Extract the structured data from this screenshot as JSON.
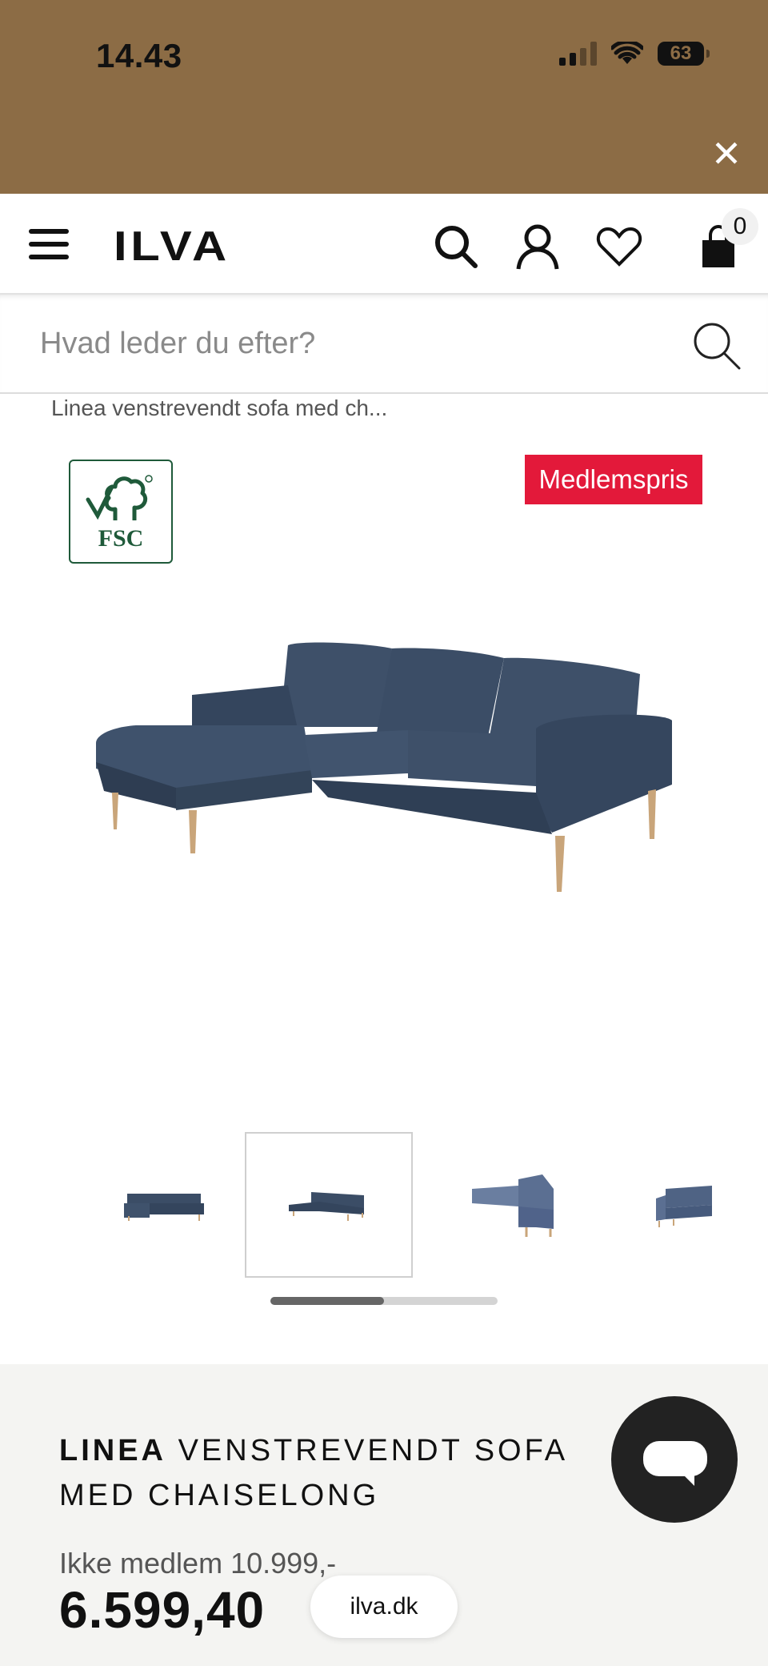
{
  "status_bar": {
    "time": "14.43",
    "battery": "63"
  },
  "promo": {
    "close_label": "✕"
  },
  "header": {
    "logo": "ILVA",
    "cart_count": "0"
  },
  "search": {
    "placeholder": "Hvad leder du efter?"
  },
  "breadcrumb": "Linea venstrevendt sofa med ch...",
  "badges": {
    "fsc": "FSC",
    "member_price_tag": "Medlemspris"
  },
  "gallery": {
    "thumbnail_count": 4,
    "active_index": 1,
    "scroll_position": 0.5
  },
  "product": {
    "brand": "LINEA",
    "name": "VENSTREVENDT SOFA MED CHAISELONG",
    "regular_price_text": "Ikke medlem 10.999,-",
    "member_price": "6.599,40"
  },
  "browser": {
    "url": "ilva.dk"
  },
  "colors": {
    "promo_bar": "#8c6c45",
    "member_tag": "#e3193a",
    "sofa": "#3b4d66",
    "fsc_green": "#1f5a3a"
  }
}
